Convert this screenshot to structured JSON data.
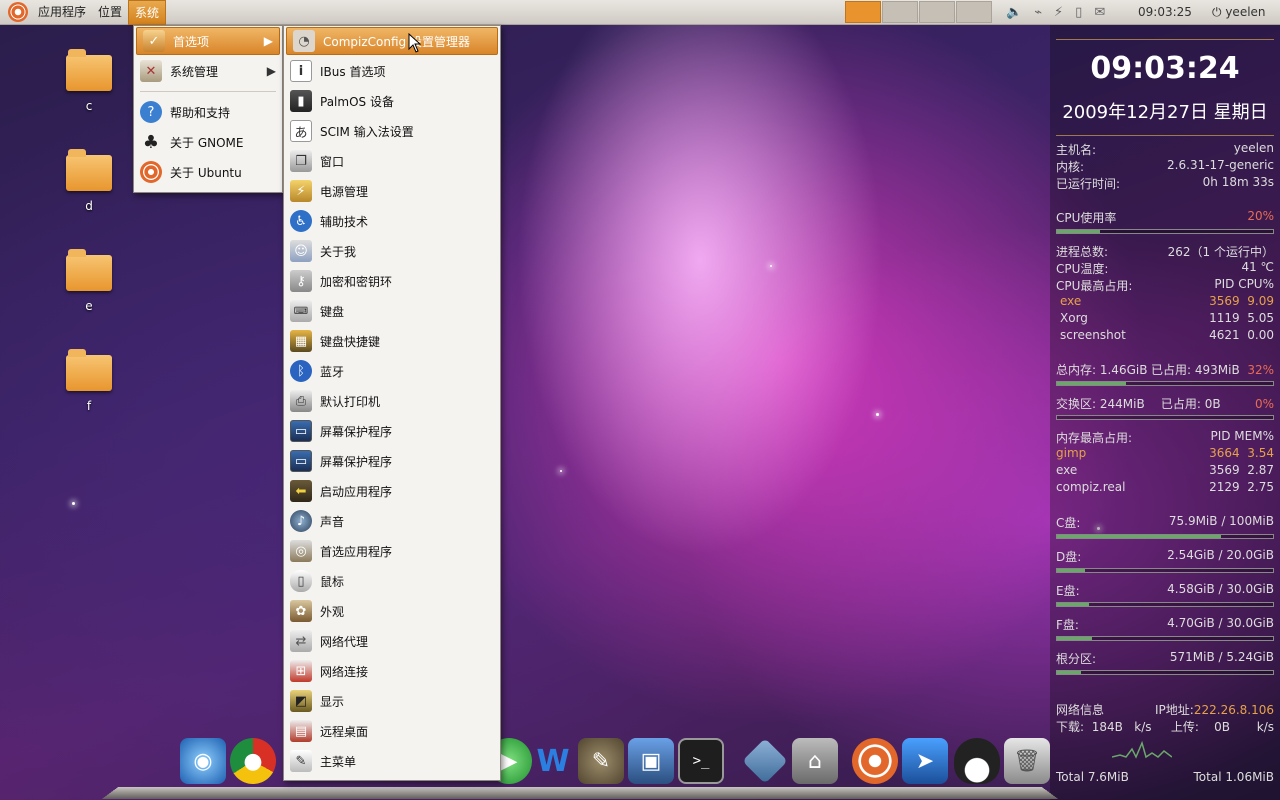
{
  "top_panel": {
    "menus": [
      "应用程序",
      "位置",
      "系统"
    ],
    "clock": "09:03:25",
    "user": "yeelen"
  },
  "desktop_icons": [
    "c",
    "d",
    "e",
    "f"
  ],
  "system_menu": {
    "items": [
      {
        "label": "首选项",
        "icon": "preferences-icon",
        "submenu": true,
        "highlighted": true
      },
      {
        "label": "系统管理",
        "icon": "administration-icon",
        "submenu": true
      },
      {
        "label": "帮助和支持",
        "icon": "help-icon"
      },
      {
        "label": "关于 GNOME",
        "icon": "gnome-foot-icon"
      },
      {
        "label": "关于 Ubuntu",
        "icon": "ubuntu-icon"
      }
    ]
  },
  "preferences_menu": {
    "items": [
      {
        "label": "CompizConfig 设置管理器",
        "icon": "compizconfig-icon",
        "highlighted": true
      },
      {
        "label": "IBus 首选项",
        "icon": "info-icon"
      },
      {
        "label": "PalmOS 设备",
        "icon": "pda-icon"
      },
      {
        "label": "SCIM 输入法设置",
        "icon": "input-method-icon"
      },
      {
        "label": "窗口",
        "icon": "windows-icon"
      },
      {
        "label": "电源管理",
        "icon": "power-icon"
      },
      {
        "label": "辅助技术",
        "icon": "accessibility-icon"
      },
      {
        "label": "关于我",
        "icon": "about-me-icon"
      },
      {
        "label": "加密和密钥环",
        "icon": "keyring-icon"
      },
      {
        "label": "键盘",
        "icon": "keyboard-icon"
      },
      {
        "label": "键盘快捷键",
        "icon": "shortcut-icon"
      },
      {
        "label": "蓝牙",
        "icon": "bluetooth-icon"
      },
      {
        "label": "默认打印机",
        "icon": "printer-icon"
      },
      {
        "label": "屏幕保护程序",
        "icon": "screensaver-icon"
      },
      {
        "label": "屏幕保护程序",
        "icon": "screensaver-icon"
      },
      {
        "label": "启动应用程序",
        "icon": "startup-icon"
      },
      {
        "label": "声音",
        "icon": "sound-icon"
      },
      {
        "label": "首选应用程序",
        "icon": "preferred-apps-icon"
      },
      {
        "label": "鼠标",
        "icon": "mouse-icon"
      },
      {
        "label": "外观",
        "icon": "appearance-icon"
      },
      {
        "label": "网络代理",
        "icon": "proxy-icon"
      },
      {
        "label": "网络连接",
        "icon": "network-icon"
      },
      {
        "label": "显示",
        "icon": "display-icon"
      },
      {
        "label": "远程桌面",
        "icon": "remote-desktop-icon"
      },
      {
        "label": "主菜单",
        "icon": "main-menu-icon"
      }
    ]
  },
  "conky": {
    "time": "09:03:24",
    "date": "2009年12月27日 星期日",
    "host_label": "主机名:",
    "host": "yeelen",
    "kernel_label": "内核:",
    "kernel": "2.6.31-17-generic",
    "uptime_label": "已运行时间:",
    "uptime": "0h 18m 33s",
    "cpu_label": "CPU使用率",
    "cpu": "20%",
    "cpu_fraction": 0.2,
    "proc_label": "进程总数:",
    "proc": "262（1   个运行中）",
    "temp_label": "CPU温度:",
    "temp": "41 ℃",
    "cpu_top_label": "CPU最高占用:",
    "cpu_top_header": "PID CPU%",
    "cpu_top": [
      {
        "name": "exe",
        "pid": "3569",
        "val": "9.09"
      },
      {
        "name": "Xorg",
        "pid": "1119",
        "val": "5.05"
      },
      {
        "name": "screenshot",
        "pid": "4621",
        "val": "0.00"
      }
    ],
    "mem_label": "总内存: 1.46GiB",
    "mem_used": "已占用: 493MiB",
    "mem_pct": "32%",
    "mem_fraction": 0.32,
    "swap_label": "交换区: 244MiB",
    "swap_used": "已占用: 0B",
    "swap_pct": "0%",
    "swap_fraction": 0.0,
    "mem_top_label": "内存最高占用:",
    "mem_top_header": "PID MEM%",
    "mem_top": [
      {
        "name": "gimp",
        "pid": "3664",
        "val": "3.54"
      },
      {
        "name": "exe",
        "pid": "3569",
        "val": "2.87"
      },
      {
        "name": "compiz.real",
        "pid": "2129",
        "val": "2.75"
      }
    ],
    "disks": [
      {
        "label": "C盘:",
        "value": "75.9MiB / 100MiB",
        "fraction": 0.76
      },
      {
        "label": "D盘:",
        "value": "2.54GiB / 20.0GiB",
        "fraction": 0.13
      },
      {
        "label": "E盘:",
        "value": "4.58GiB / 30.0GiB",
        "fraction": 0.15
      },
      {
        "label": "F盘:",
        "value": "4.70GiB / 30.0GiB",
        "fraction": 0.16
      },
      {
        "label": "根分区:",
        "value": "571MiB  / 5.24GiB",
        "fraction": 0.11
      }
    ],
    "net_label": "网络信息",
    "ip_label": "IP地址:",
    "ip": "222.26.8.106",
    "down_label": "下载:",
    "down": "184B",
    "up_label": "上传:",
    "up": "0B",
    "unit": "k/s",
    "total_down": "Total 7.6MiB",
    "total_up": "Total 1.06MiB"
  },
  "dock_icons": [
    "swiftfox-icon",
    "chrome-icon",
    "media-player-icon",
    "writer-icon",
    "gimp-icon",
    "photos-icon",
    "terminal-icon",
    "filezilla-icon",
    "home-icon",
    "ubuntu-icon",
    "cursor-icon",
    "tux-icon",
    "trash-icon",
    "disc-icon"
  ]
}
